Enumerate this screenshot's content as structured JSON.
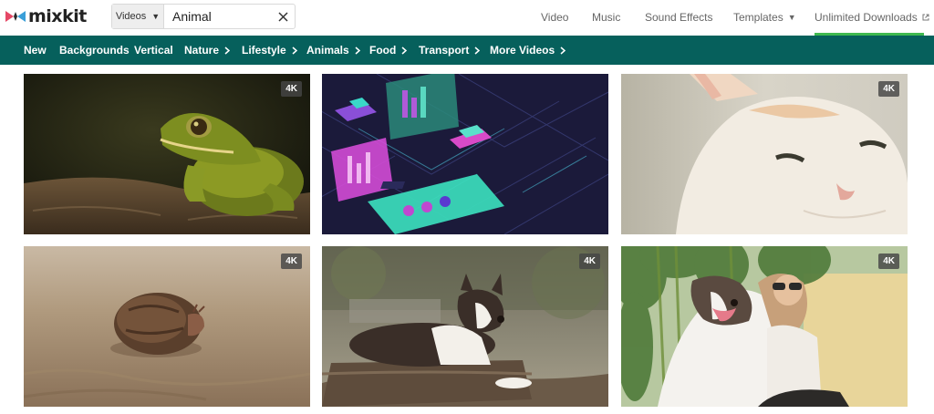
{
  "brand": {
    "name": "mixkit"
  },
  "search": {
    "category": "Videos",
    "query": "Animal"
  },
  "topnav": {
    "video": "Video",
    "music": "Music",
    "sound_effects": "Sound Effects",
    "templates": "Templates",
    "unlimited": "Unlimited Downloads"
  },
  "categories": [
    {
      "label": "New",
      "chevron": false
    },
    {
      "label": "Backgrounds",
      "chevron": false
    },
    {
      "label": "Vertical",
      "chevron": false
    },
    {
      "label": "Nature",
      "chevron": true
    },
    {
      "label": "Lifestyle",
      "chevron": true
    },
    {
      "label": "Animals",
      "chevron": true
    },
    {
      "label": "Food",
      "chevron": true
    },
    {
      "label": "Transport",
      "chevron": true
    },
    {
      "label": "More Videos",
      "chevron": true
    }
  ],
  "videos": [
    {
      "scene": "frog",
      "badge": "4K"
    },
    {
      "scene": "isometric-ui",
      "badge": ""
    },
    {
      "scene": "cat",
      "badge": "4K"
    },
    {
      "scene": "hermit-crab",
      "badge": "4K"
    },
    {
      "scene": "border-collie",
      "badge": "4K"
    },
    {
      "scene": "girl-and-dog",
      "badge": "4K"
    }
  ],
  "colors": {
    "brand_teal": "#06605c",
    "active_green": "#3fb950",
    "logo_pink": "#e54866",
    "logo_blue": "#3a9fd8"
  },
  "icons": [
    "mixkit-logo-icon",
    "caret-down-icon",
    "close-icon",
    "chevron-right-icon",
    "external-link-icon"
  ]
}
